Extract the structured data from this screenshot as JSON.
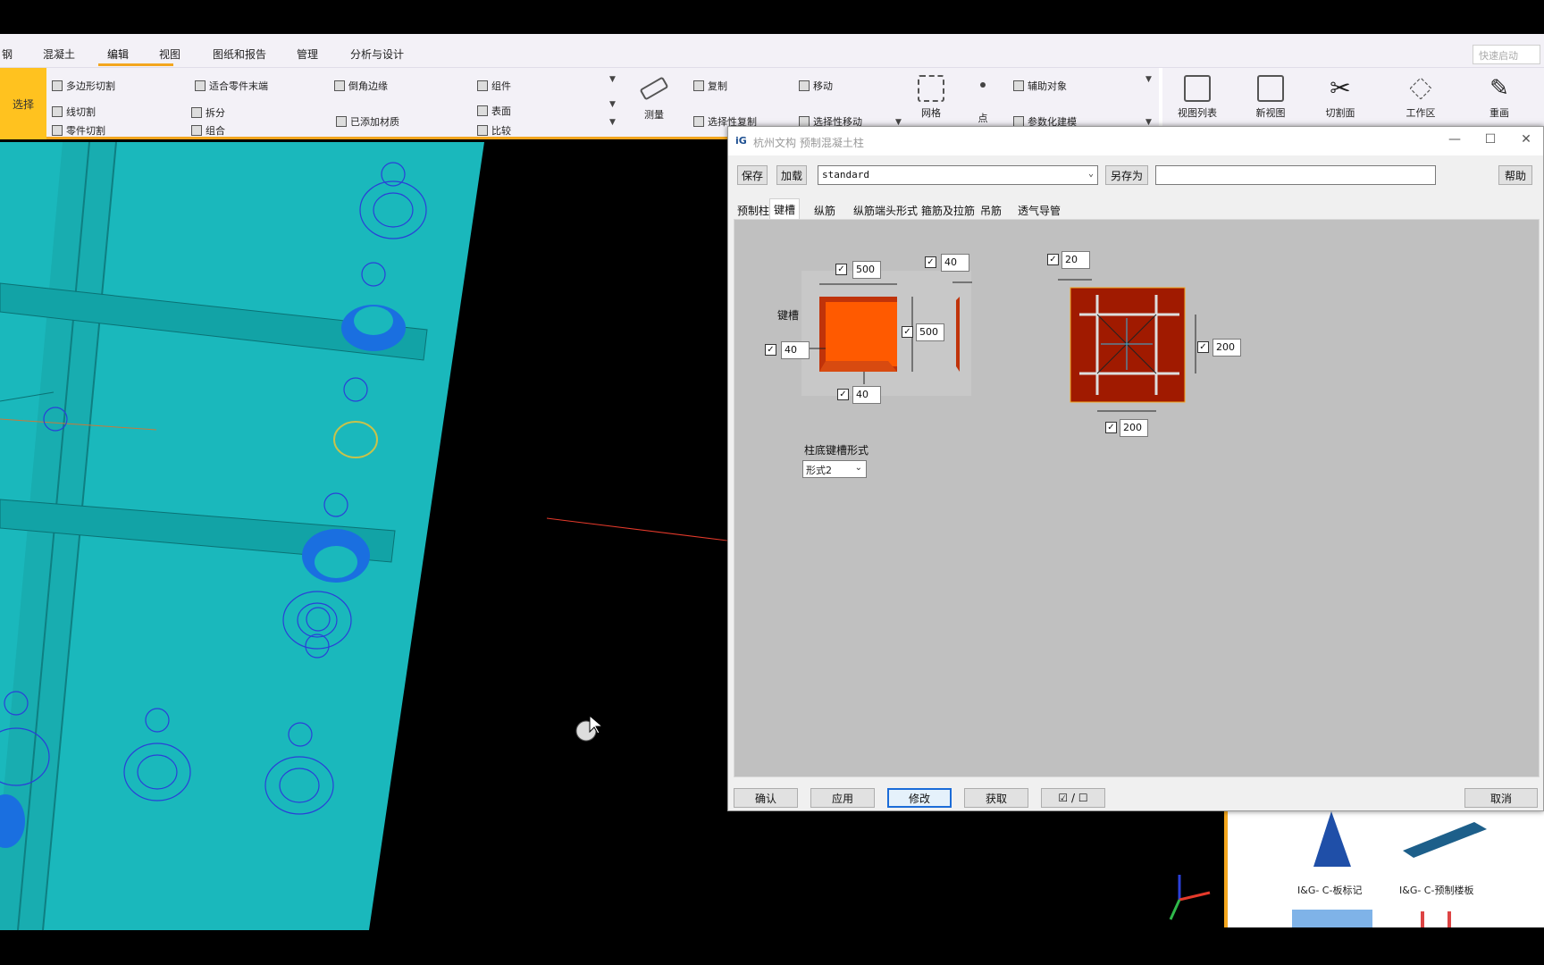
{
  "ribbon_tabs": [
    "钢",
    "混凝土",
    "编辑",
    "视图",
    "图纸和报告",
    "管理",
    "分析与设计"
  ],
  "quick_launch_placeholder": "快速启动",
  "ribbon": {
    "select": "选择",
    "polygon_cut": "多边形切割",
    "line_cut": "线切割",
    "part_cut": "零件切割",
    "fit_part_end": "适合零件末端",
    "split": "拆分",
    "combine": "组合",
    "chamfer_edge": "倒角边缘",
    "added_material": "已添加材质",
    "component": "组件",
    "surface": "表面",
    "compare": "比较",
    "measure": "测量",
    "copy": "复制",
    "selective_copy": "选择性复制",
    "move": "移动",
    "selective_move": "选择性移动",
    "grid": "网格",
    "point": "点",
    "helper_object": "辅助对象",
    "parametric_modeling": "参数化建模",
    "view_list": "视图列表",
    "new_view": "新视图",
    "cut_plane": "切割面",
    "work_area": "工作区",
    "redraw": "重画"
  },
  "dialog": {
    "logo": "iG",
    "title": "杭州文构 预制混凝土柱",
    "save": "保存",
    "load": "加载",
    "preset": "standard",
    "save_as": "另存为",
    "save_as_name": "",
    "help": "帮助",
    "tabs": [
      "预制柱",
      "键槽",
      "纵筋",
      "纵筋端头形式",
      "箍筋及拉筋",
      "吊筋",
      "透气导管"
    ],
    "active_tab": 1,
    "keyway": {
      "label": "键槽",
      "width_top": "500",
      "height_right": "500",
      "left_offset": "40",
      "bottom_offset": "40",
      "depth": "40",
      "spacing_top": "20",
      "side_right": "200",
      "side_bottom": "200",
      "base_form_label": "柱底键槽形式",
      "base_form_value": "形式2"
    },
    "footer": {
      "ok": "确认",
      "apply": "应用",
      "modify": "修改",
      "get": "获取",
      "toggle": "☑ / ☐",
      "cancel": "取消"
    }
  },
  "family_panel": {
    "item1": "I&G- C-板标记",
    "item2": "I&G- C-预制楼板"
  }
}
